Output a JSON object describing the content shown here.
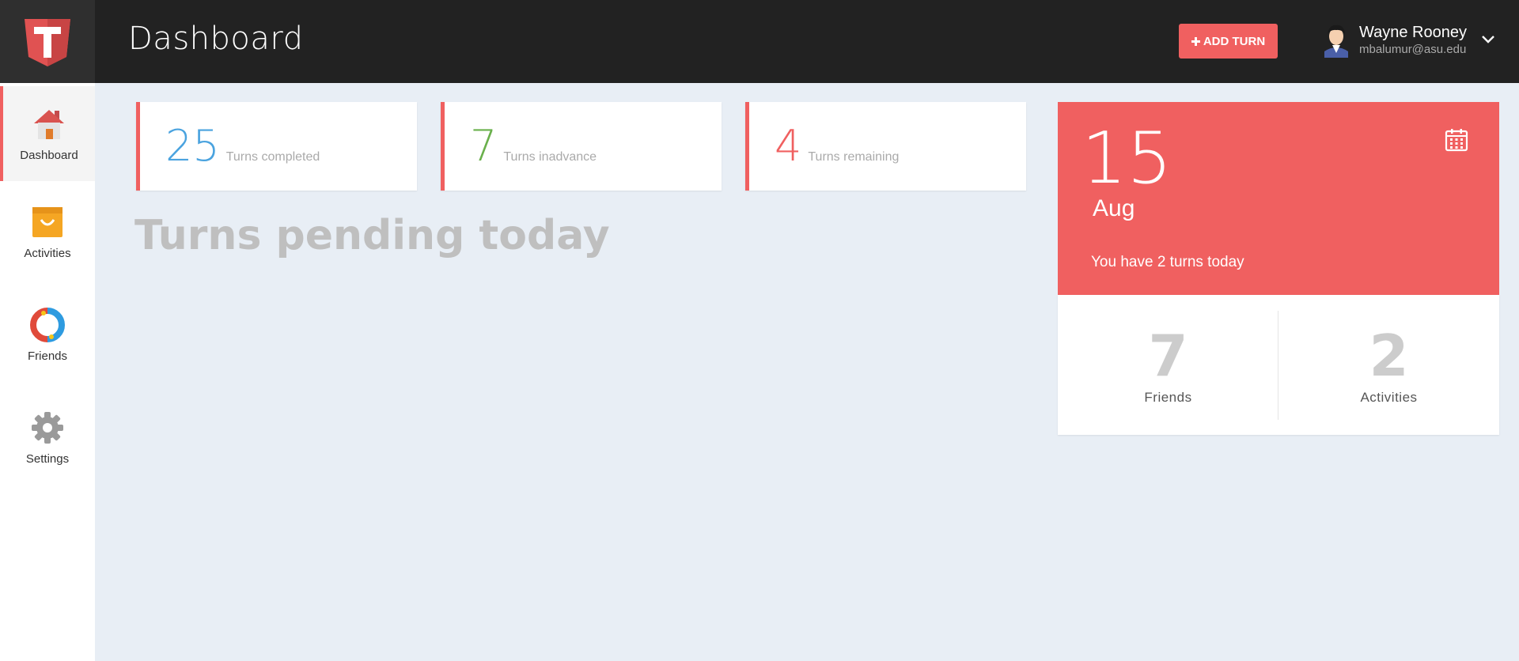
{
  "header": {
    "title": "Dashboard",
    "add_button_label": "ADD TURN",
    "add_button_icon": "plus-icon",
    "user": {
      "name": "Wayne Rooney",
      "email": "mbalumur@asu.edu"
    }
  },
  "sidebar": {
    "items": [
      {
        "label": "Dashboard",
        "icon": "home-icon",
        "active": true
      },
      {
        "label": "Activities",
        "icon": "shopping-bag-icon",
        "active": false
      },
      {
        "label": "Friends",
        "icon": "friends-ring-icon",
        "active": false
      },
      {
        "label": "Settings",
        "icon": "gear-icon",
        "active": false
      }
    ]
  },
  "stats": [
    {
      "value": "25",
      "label": "Turns completed",
      "color": "#4aa3df"
    },
    {
      "value": "7",
      "label": "Turns inadvance",
      "color": "#6ab04c"
    },
    {
      "value": "4",
      "label": "Turns remaining",
      "color": "#f06060"
    }
  ],
  "main": {
    "pending_title": "Turns pending today"
  },
  "date_card": {
    "day": "15",
    "month": "Aug",
    "message": "You have 2 turns today",
    "icon": "calendar-icon"
  },
  "counts": [
    {
      "value": "7",
      "label": "Friends"
    },
    {
      "value": "2",
      "label": "Activities"
    }
  ],
  "colors": {
    "accent": "#f06060",
    "topbar": "#222222",
    "background": "#e8eef5"
  }
}
